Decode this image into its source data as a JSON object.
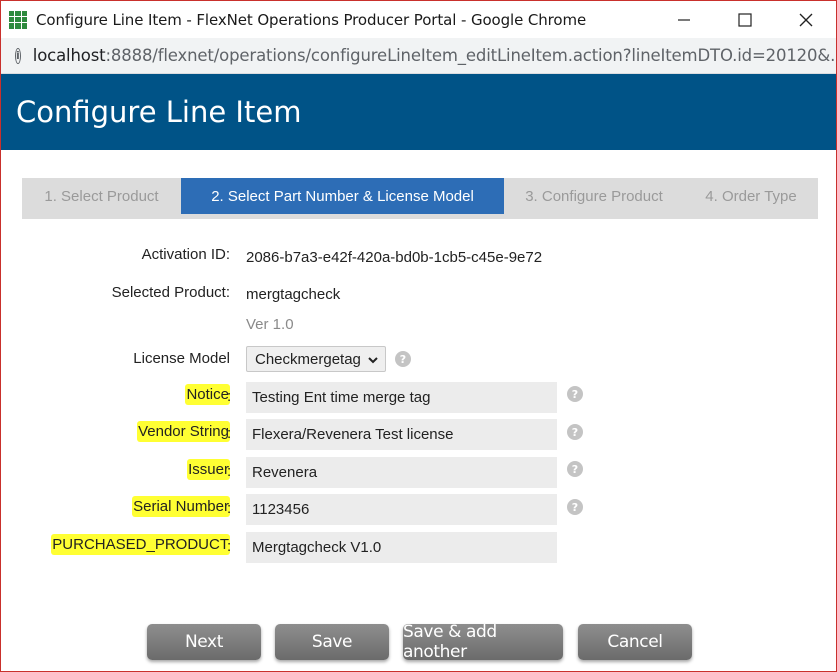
{
  "window": {
    "title": "Configure Line Item - FlexNet Operations Producer Portal - Google Chrome",
    "icon": "app-grid-icon"
  },
  "address_bar": {
    "host": "localhost",
    "rest": ":8888/flexnet/operations/configureLineItem_editLineItem.action?lineItemDTO.id=20120&..."
  },
  "header": {
    "title": "Configure Line Item"
  },
  "steps": [
    {
      "label": "1. Select Product",
      "active": false
    },
    {
      "label": "2. Select Part Number & License Model",
      "active": true
    },
    {
      "label": "3. Configure Product",
      "active": false
    },
    {
      "label": "4. Order Type",
      "active": false
    }
  ],
  "form": {
    "activation_id": {
      "label": "Activation ID:",
      "value": "2086-b7a3-e42f-420a-bd0b-1cb5-c45e-9e72"
    },
    "selected_product": {
      "label": "Selected Product:",
      "value": "mergtagcheck",
      "version": "Ver 1.0"
    },
    "license_model": {
      "label": "License Model",
      "value": "Checkmergetag"
    },
    "notice": {
      "label": "Notice",
      "value": "Testing Ent time merge tag"
    },
    "vendor_string": {
      "label": "Vendor String",
      "value": "Flexera/Revenera Test license"
    },
    "issuer": {
      "label": "Issuer",
      "value": "Revenera"
    },
    "serial_number": {
      "label": "Serial Number",
      "value": "1123456"
    },
    "purchased_product": {
      "label": "PURCHASED_PRODUCT",
      "value": "Mergtagcheck V1.0"
    },
    "colon": ":",
    "help_glyph": "?"
  },
  "buttons": {
    "next": "Next",
    "save": "Save",
    "save_add": "Save & add another",
    "cancel": "Cancel"
  },
  "colors": {
    "header_bg": "#005387",
    "active_step": "#2d6db6",
    "highlight": "#ffff33",
    "button_bg": "#7a7a7a"
  }
}
